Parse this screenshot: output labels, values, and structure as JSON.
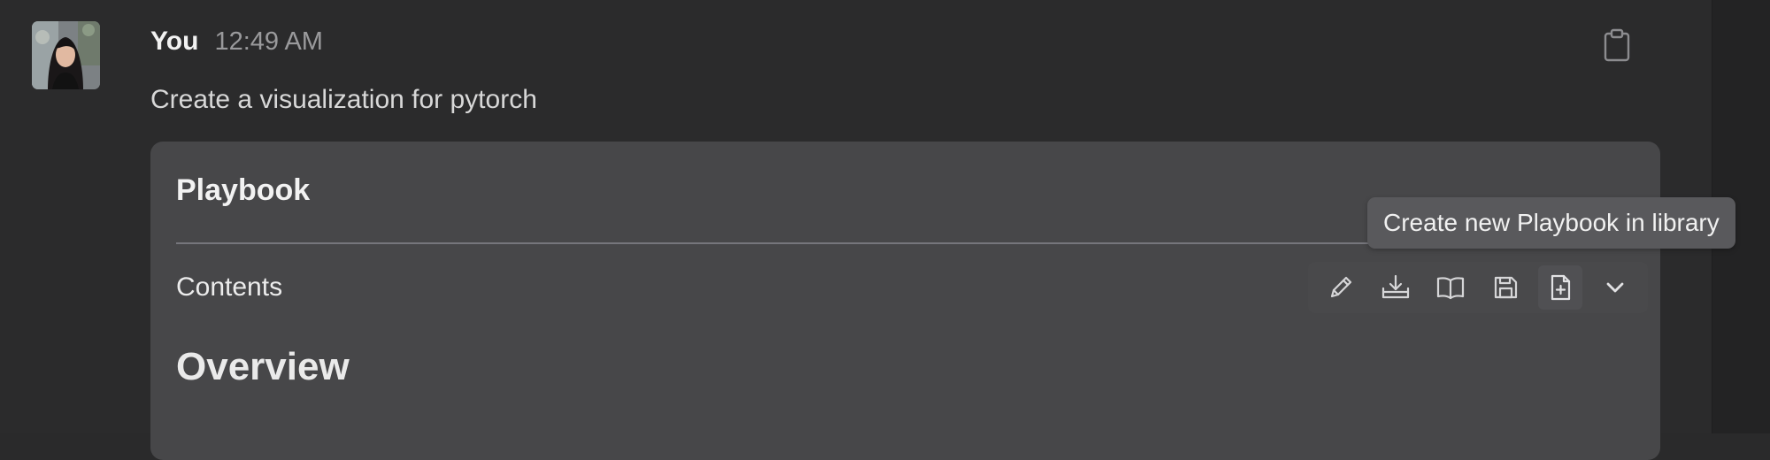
{
  "message": {
    "sender": "You",
    "time": "12:49 AM",
    "text": "Create a visualization for pytorch",
    "copy_icon": "clipboard-icon",
    "avatar_icon": "user-avatar"
  },
  "card": {
    "title": "Playbook",
    "contents_label": "Contents",
    "heading": "Overview",
    "tooltip": "Create new Playbook in library",
    "toolbar": {
      "icons": [
        "pencil-icon",
        "download-icon",
        "book-open-icon",
        "save-icon",
        "file-plus-icon",
        "chevron-down-icon"
      ],
      "active_index": 4
    }
  },
  "colors": {
    "background": "#2b2b2c",
    "card_background": "#474749",
    "tooltip_background": "#59595c",
    "muted_text": "#9a9a9c"
  }
}
